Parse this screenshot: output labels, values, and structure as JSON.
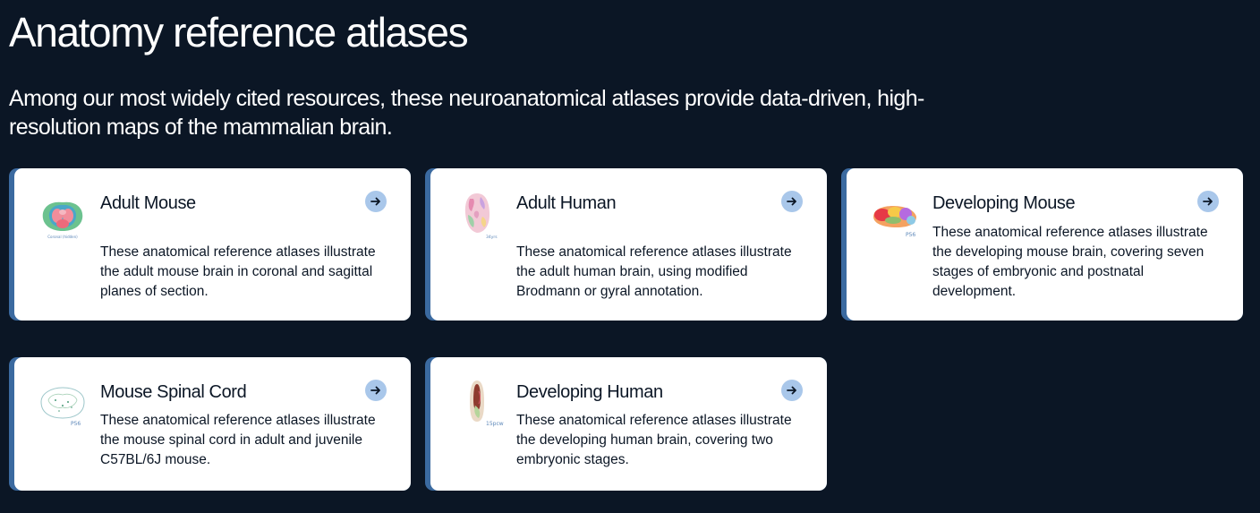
{
  "header": {
    "title": "Anatomy reference atlases",
    "intro": "Among our most widely cited resources, these neuroanatomical atlases provide data-driven, high-resolution maps of the mammalian brain."
  },
  "cards": [
    {
      "title": "Adult Mouse",
      "description": "These anatomical reference atlases illustrate the adult mouse brain in coronal and sagittal planes of section.",
      "thumb_icon": "mouse-brain-coronal-thumbnail",
      "thumb_caption": "Coronal (hidden)"
    },
    {
      "title": "Adult Human",
      "description": "These anatomical reference atlases illustrate the adult human brain, using modified Brodmann or gyral annotation.",
      "thumb_icon": "human-brain-section-thumbnail",
      "thumb_caption": "34yrs"
    },
    {
      "title": "Developing Mouse",
      "description": "These anatomical reference atlases illustrate the developing mouse brain, covering seven stages of embryonic and postnatal development.",
      "thumb_icon": "mouse-brain-sagittal-thumbnail",
      "thumb_caption": "P56"
    },
    {
      "title": "Mouse Spinal Cord",
      "description": "These anatomical reference atlases illustrate the mouse spinal cord in adult and juvenile C57BL/6J mouse.",
      "thumb_icon": "spinal-cord-section-thumbnail",
      "thumb_caption": "P56"
    },
    {
      "title": "Developing Human",
      "description": "These anatomical reference atlases illustrate the developing human brain, covering two embryonic stages.",
      "thumb_icon": "fetal-brain-section-thumbnail",
      "thumb_caption": "15pcw"
    }
  ],
  "colors": {
    "background": "#0b1625",
    "card_background": "#ffffff",
    "card_accent_border": "#3b6aa0",
    "arrow_button": "#a9c7ea",
    "text_dark": "#0b1625"
  }
}
